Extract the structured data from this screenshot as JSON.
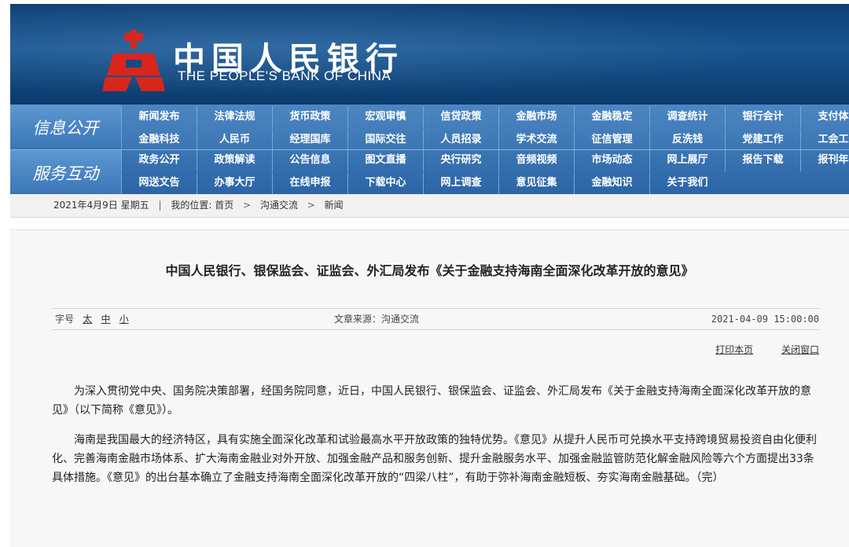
{
  "header": {
    "cn_name": "中国人民银行",
    "en_name": "THE PEOPLE'S BANK OF CHINA",
    "banner_color": "#134a84",
    "logo_color": "#d8261c"
  },
  "nav": {
    "section_1": "信息公开",
    "section_2": "服务互动",
    "row1": [
      "新闻发布",
      "法律法规",
      "货币政策",
      "宏观审慎",
      "信贷政策",
      "金融市场",
      "金融稳定",
      "调查统计",
      "银行会计",
      "支付体系"
    ],
    "row2": [
      "金融科技",
      "人民币",
      "经理国库",
      "国际交往",
      "人员招录",
      "学术交流",
      "征信管理",
      "反洗钱",
      "党建工作",
      "工会工作"
    ],
    "row3": [
      "政务公开",
      "政策解读",
      "公告信息",
      "图文直播",
      "央行研究",
      "音频视频",
      "市场动态",
      "网上展厅",
      "报告下载",
      "报刊年鉴"
    ],
    "row4": [
      "网送文告",
      "办事大厅",
      "在线申报",
      "下载中心",
      "网上调查",
      "意见征集",
      "金融知识",
      "关于我们"
    ]
  },
  "breadcrumb": {
    "date": "2021年4月9日 星期五",
    "location_label": "我的位置:",
    "home": "首页",
    "level1": "沟通交流",
    "level2": "新闻"
  },
  "article": {
    "title": "中国人民银行、银保监会、证监会、外汇局发布《关于金融支持海南全面深化改革开放的意见》",
    "font_size_label": "字号",
    "font_large": "太",
    "font_medium": "中",
    "font_small": "小",
    "source": "文章来源：沟通交流",
    "datetime": "2021-04-09 15:00:00",
    "print_link": "打印本页",
    "close_link": "关闭窗口",
    "paragraphs": [
      "为深入贯彻党中央、国务院决策部署，经国务院同意，近日，中国人民银行、银保监会、证监会、外汇局发布《关于金融支持海南全面深化改革开放的意见》（以下简称《意见》）。",
      "海南是我国最大的经济特区，具有实施全面深化改革和试验最高水平开放政策的独特优势。《意见》从提升人民币可兑换水平支持跨境贸易投资自由化便利化、完善海南金融市场体系、扩大海南金融业对外开放、加强金融产品和服务创新、提升金融服务水平、加强金融监管防范化解金融风险等六个方面提出33条具体措施。《意见》的出台基本确立了金融支持海南全面深化改革开放的“四梁八柱”，有助于弥补海南金融短板、夯实海南金融基础。（完）"
    ]
  }
}
